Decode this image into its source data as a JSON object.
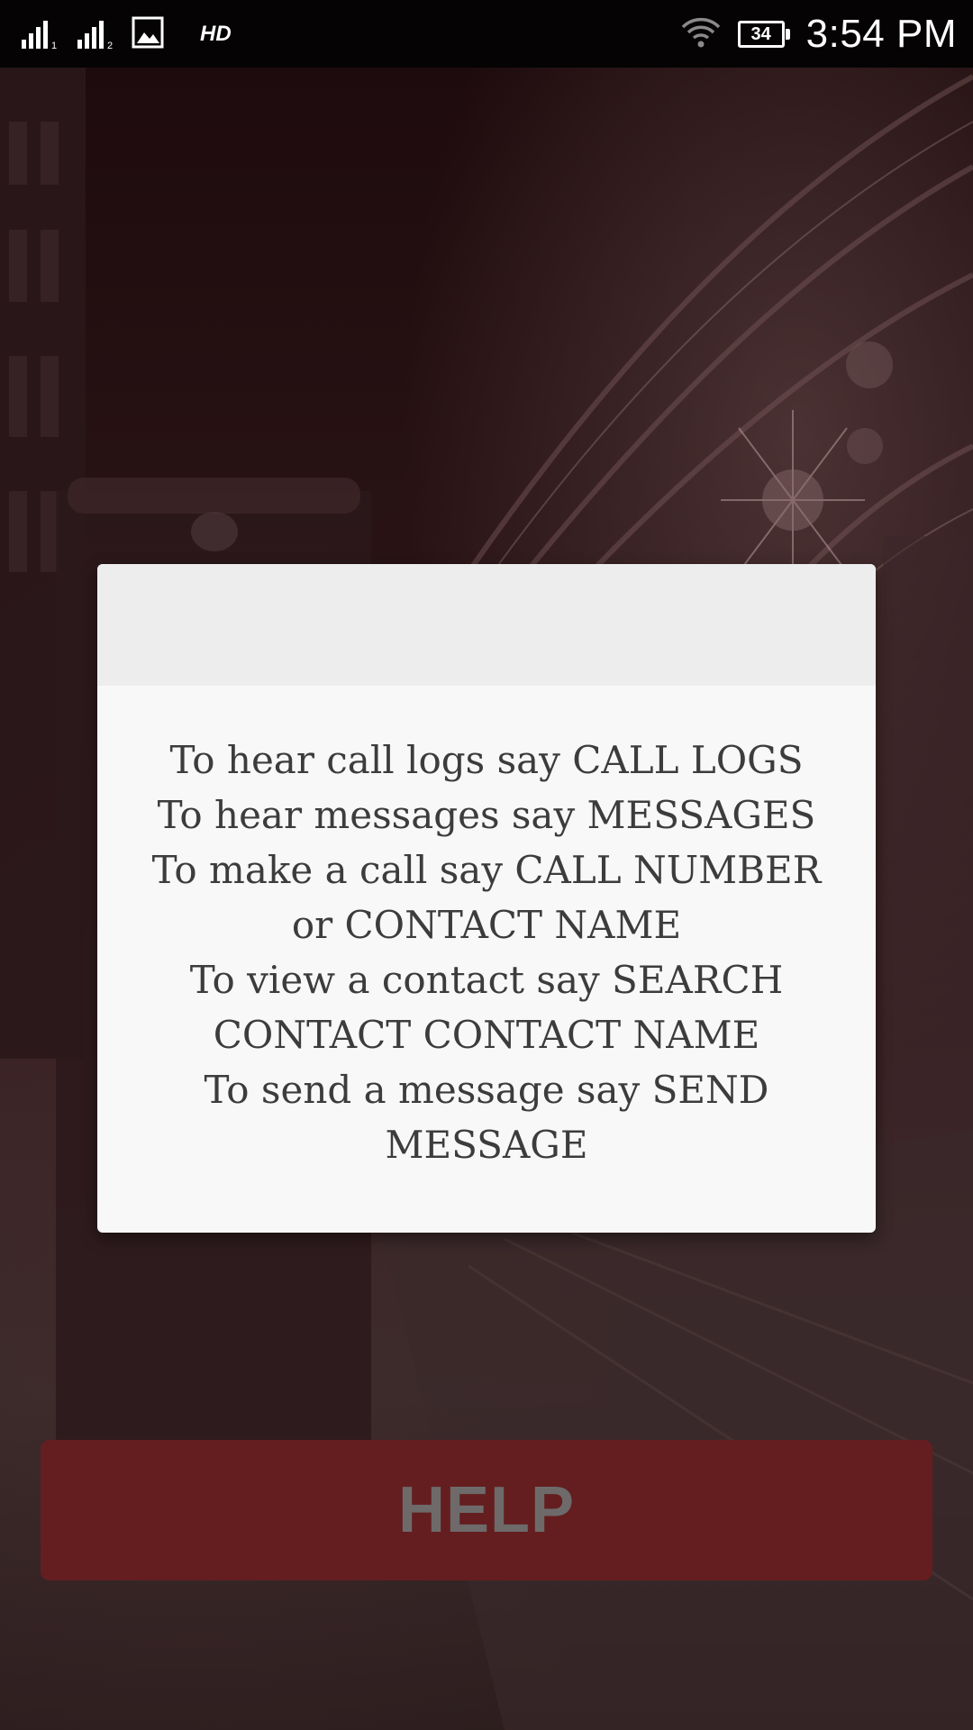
{
  "status_bar": {
    "sim1_label": "1",
    "sim2_label": "2",
    "hd_label": "HD",
    "battery_level": "34",
    "time": "3:54 PM",
    "icons": [
      "signal-sim1-icon",
      "signal-sim2-icon",
      "gallery-icon",
      "wifi-icon",
      "battery-icon"
    ]
  },
  "dialog": {
    "title": "",
    "lines": [
      "To hear call logs say CALL LOGS",
      "To hear messages say MESSAGES",
      "To make a call say CALL NUMBER",
      "or CONTACT NAME",
      "To view a contact say SEARCH",
      "CONTACT CONTACT NAME",
      "To send a message say SEND",
      "MESSAGE"
    ]
  },
  "help_button": {
    "label": "HELP"
  },
  "colors": {
    "status_bar_bg": "#050303",
    "dialog_bg": "#f8f8f8",
    "dialog_header_bg": "#ededed",
    "dialog_text": "#3c3c3c",
    "button_bg": "#641e20",
    "button_text": "#6e6a6a"
  }
}
